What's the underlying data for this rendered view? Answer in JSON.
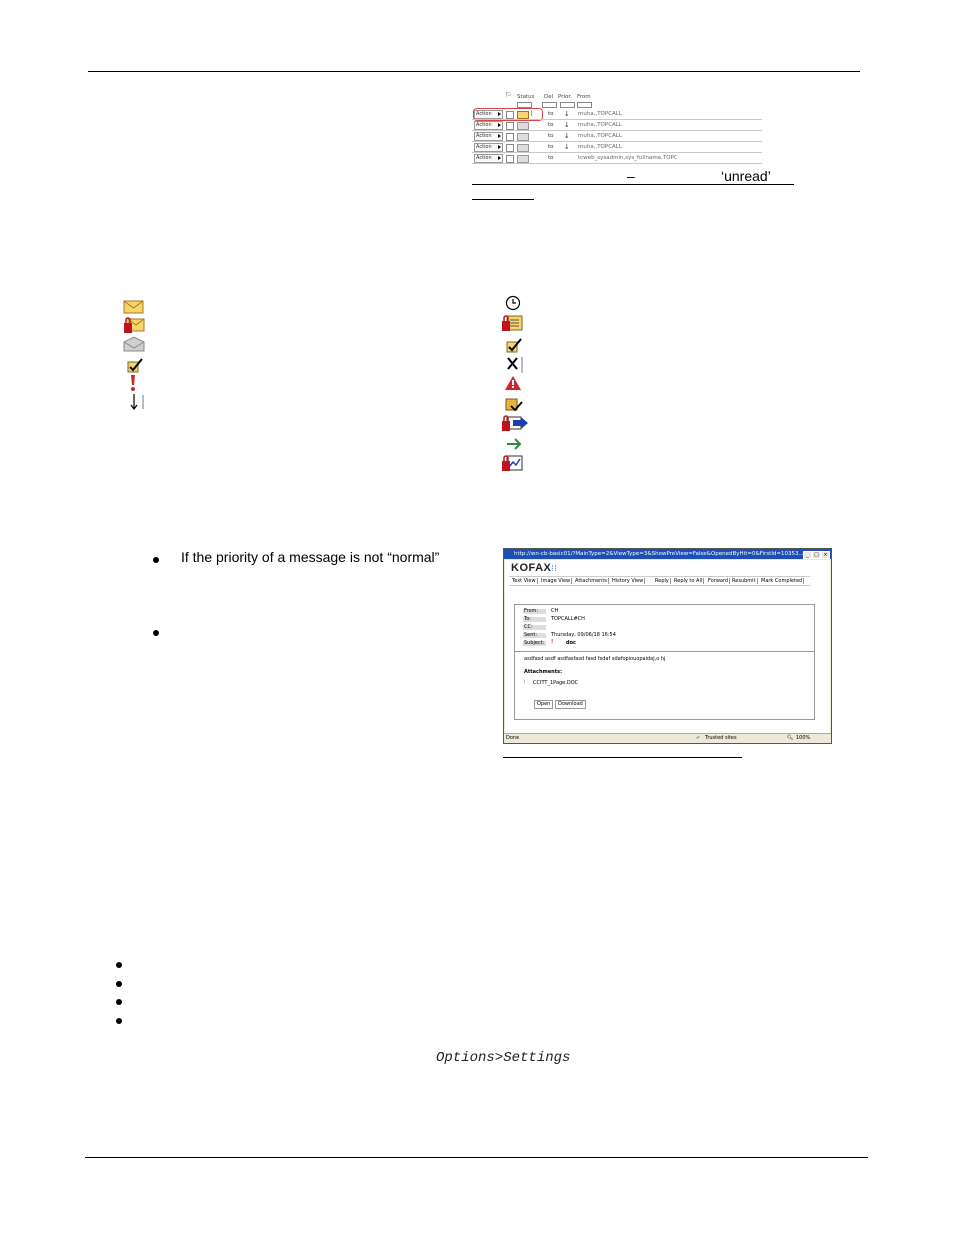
{
  "inbox_table": {
    "columns": [
      "Status",
      "Del",
      "Prior.",
      "From"
    ],
    "rows": [
      {
        "action": "Action",
        "del": "to",
        "prior": "↓",
        "from": "muha,,TOPCALL",
        "state": "unread",
        "attach": true
      },
      {
        "action": "Action",
        "del": "to",
        "prior": "↓",
        "from": "muha,,TOPCALL",
        "state": "read",
        "attach": false
      },
      {
        "action": "Action",
        "del": "to",
        "prior": "↓",
        "from": "muha,,TOPCALL",
        "state": "read",
        "attach": false
      },
      {
        "action": "Action",
        "del": "to",
        "prior": "↓",
        "from": "muha,,TOPCALL",
        "state": "read",
        "attach": false
      },
      {
        "action": "Action",
        "del": "to",
        "prior": "",
        "from": "tcweb_sysadmin,sys_fullname,TOPC",
        "state": "read",
        "attach": false
      }
    ]
  },
  "caption1": {
    "dash": "–",
    "unread": "‘unread’"
  },
  "left_icons": [
    "envelope-unread-icon",
    "locked-envelope-icon",
    "envelope-read-icon",
    "checkmark-icon",
    "exclamation-icon",
    "arrow-down-icon"
  ],
  "right_icons": [
    "clock-icon",
    "locked-notepad-icon",
    "checkmark-icon",
    "cross-icon",
    "warning-icon",
    "document-check-icon",
    "locked-forward-icon",
    "green-arrow-icon",
    "locked-chart-icon"
  ],
  "bullets": {
    "b1": "If the priority of a message is not “normal”"
  },
  "browser": {
    "title": "http://wn-cb-basic01/?MainType=2&ViewType=3&ShowPreView=False&OpenedByHit=0&FirstId=10353...",
    "logo": "KOFAX",
    "toolbar": [
      "Text View",
      "Image View",
      "Attachments",
      "History View",
      "Reply",
      "Reply to All",
      "Forward",
      "Resubmit",
      "Mark Completed"
    ],
    "fields": {
      "from_label": "From:",
      "from": "CH",
      "to_label": "To:",
      "to": "TOPCALL#CH",
      "cc_label": "CC:",
      "cc": "",
      "sent_label": "Sent:",
      "sent": "Thursday, 09/06/18 16:54",
      "subject_label": "Subject:",
      "subject": "doc"
    },
    "body": "asdfasd asdf asdfasfasd fasd fsdaf sdafopiouopaidaj,o hj",
    "attachments_label": "Attachments:",
    "attachment": "CCITT_1Page.DOC",
    "open": "Open",
    "download": "Download",
    "status_done": "Done",
    "status_zone": "Trusted sites",
    "zoom": "100%"
  },
  "settings_path": "Options>Settings"
}
